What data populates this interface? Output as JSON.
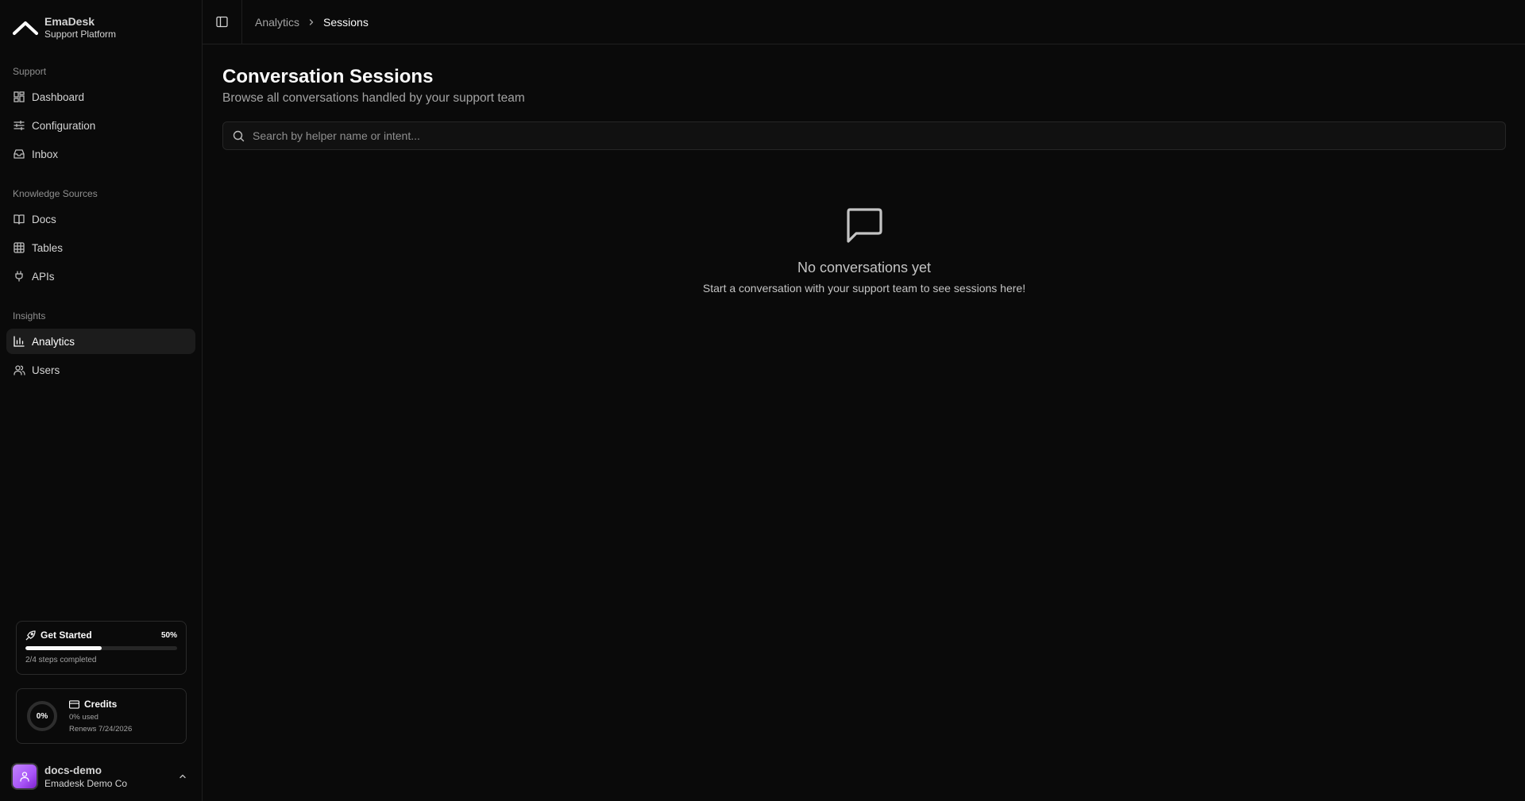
{
  "brand": {
    "name": "EmaDesk",
    "subtitle": "Support Platform"
  },
  "sidebar": {
    "sections": [
      {
        "label": "Support",
        "items": [
          {
            "label": "Dashboard",
            "icon": "dashboard-icon"
          },
          {
            "label": "Configuration",
            "icon": "sliders-icon"
          },
          {
            "label": "Inbox",
            "icon": "inbox-icon"
          }
        ]
      },
      {
        "label": "Knowledge Sources",
        "items": [
          {
            "label": "Docs",
            "icon": "book-icon"
          },
          {
            "label": "Tables",
            "icon": "table-icon"
          },
          {
            "label": "APIs",
            "icon": "plug-icon"
          }
        ]
      },
      {
        "label": "Insights",
        "items": [
          {
            "label": "Analytics",
            "icon": "bar-chart-icon",
            "active": true
          },
          {
            "label": "Users",
            "icon": "users-icon"
          }
        ]
      }
    ]
  },
  "get_started": {
    "title": "Get Started",
    "percent_label": "50%",
    "progress": 0.5,
    "steps": "2/4 steps completed"
  },
  "credits": {
    "title": "Credits",
    "ring_label": "0%",
    "used": "0% used",
    "renews": "Renews 7/24/2026",
    "used_fraction": 0
  },
  "user": {
    "name": "docs-demo",
    "org": "Emadesk Demo Co"
  },
  "breadcrumb": {
    "parent": "Analytics",
    "current": "Sessions"
  },
  "page": {
    "title": "Conversation Sessions",
    "subtitle": "Browse all conversations handled by your support team"
  },
  "search": {
    "placeholder": "Search by helper name or intent...",
    "value": ""
  },
  "empty_state": {
    "title": "No conversations yet",
    "message": "Start a conversation with your support team to see sessions here!"
  },
  "colors": {
    "background": "#0a0a0a",
    "active_item": "#1c1c1c",
    "avatar": "#a855f7"
  }
}
